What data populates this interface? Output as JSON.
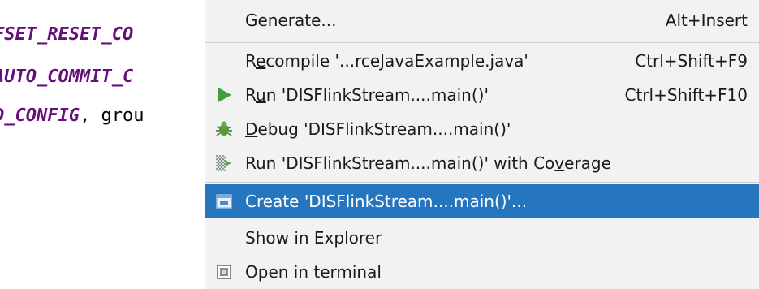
{
  "editor": {
    "lines": [
      {
        "const": "FSET_RESET_CO",
        "rest": ""
      },
      {
        "const": "AUTO_COMMIT_C",
        "rest": ""
      },
      {
        "const": "D_CONFIG",
        "rest": ", grou"
      }
    ]
  },
  "menu": {
    "generate": {
      "label": "Generate...",
      "shortcut": "Alt+Insert"
    },
    "recompile": {
      "pre": "R",
      "u": "e",
      "post": "compile '...rceJavaExample.java'",
      "shortcut": "Ctrl+Shift+F9"
    },
    "run": {
      "pre": "R",
      "u": "u",
      "post": "n 'DISFlinkStream....main()'",
      "shortcut": "Ctrl+Shift+F10",
      "icon": "run-icon",
      "icon_color": "#3e9e41"
    },
    "debug": {
      "pre": "",
      "u": "D",
      "post": "ebug 'DISFlinkStream....main()'",
      "icon": "debug-icon"
    },
    "coverage": {
      "pre": "Run 'DISFlinkStream....main()' with Co",
      "u": "v",
      "post": "erage",
      "icon": "coverage-icon"
    },
    "create": {
      "label": "Create 'DISFlinkStream....main()'...",
      "icon": "create-config-icon",
      "selected_color": "#2675bf"
    },
    "show_in_explorer": {
      "label": "Show in Explorer"
    },
    "open_in_terminal": {
      "label": "Open in terminal",
      "icon": "terminal-icon"
    }
  }
}
